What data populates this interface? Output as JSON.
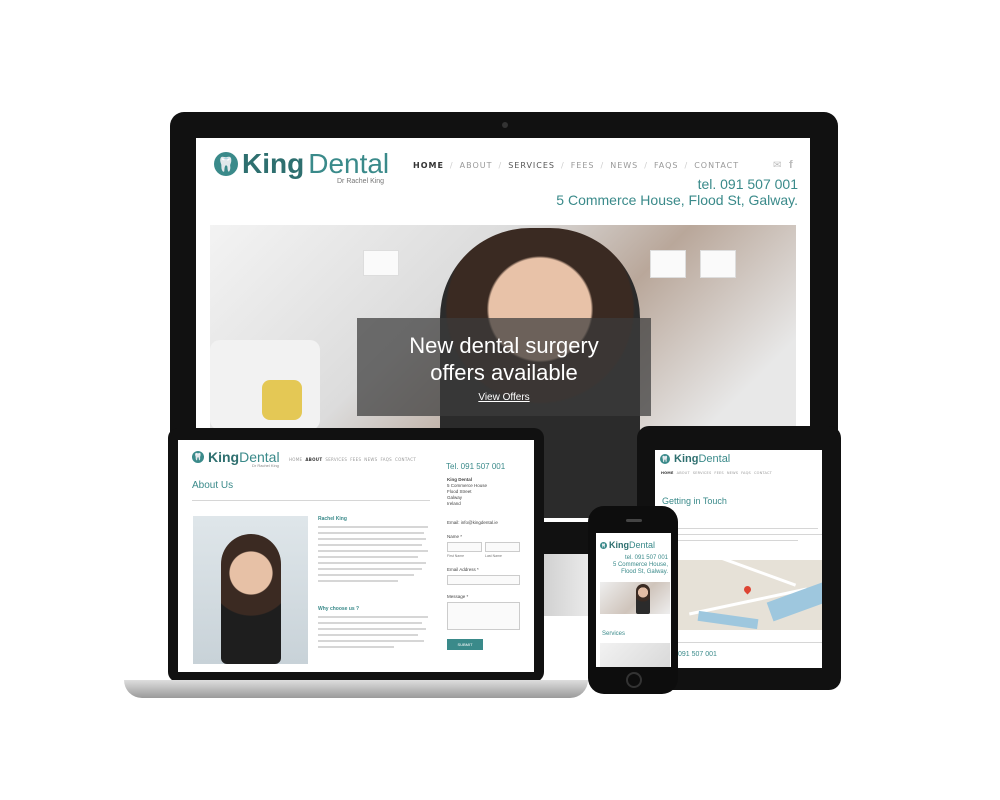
{
  "brand": {
    "king": "King",
    "dental": "Dental",
    "subtitle": "Dr Rachel King",
    "tooth_icon": "tooth-icon"
  },
  "colors": {
    "accent": "#3a8a8a",
    "dark": "#111111"
  },
  "desktop": {
    "nav": [
      "HOME",
      "ABOUT",
      "SERVICES",
      "FEES",
      "NEWS",
      "FAQS",
      "CONTACT"
    ],
    "phone": "tel. 091 507 001",
    "address": "5 Commerce House, Flood St, Galway.",
    "hero_line1": "New dental surgery",
    "hero_line2": "offers available",
    "hero_link": "View Offers"
  },
  "laptop": {
    "nav": [
      "HOME",
      "ABOUT",
      "SERVICES",
      "FEES",
      "NEWS",
      "FAQS",
      "CONTACT"
    ],
    "heading": "About Us",
    "phone": "Tel. 091 507 001",
    "name": "Rachel King",
    "why": "Why choose us ?",
    "contact_title": "King Dental",
    "address": [
      "5 Commerce House",
      "Flood Street",
      "Galway",
      "Ireland"
    ],
    "email": "Email: info@kingdental.ie",
    "form_name": "Name *",
    "first_name": "First Name",
    "last_name": "Last Name",
    "form_email": "Email Address *",
    "form_message": "Message *",
    "submit": "SUBMIT"
  },
  "tablet": {
    "nav": [
      "HOME",
      "ABOUT",
      "SERVICES",
      "FEES",
      "NEWS",
      "FAQS",
      "CONTACT"
    ],
    "heading": "Getting in Touch",
    "phone": "091 507 001"
  },
  "phone": {
    "tel": "tel. 091 507 001",
    "address_line1": "5 Commerce House,",
    "address_line2": "Flood St, Galway.",
    "section": "Services"
  }
}
